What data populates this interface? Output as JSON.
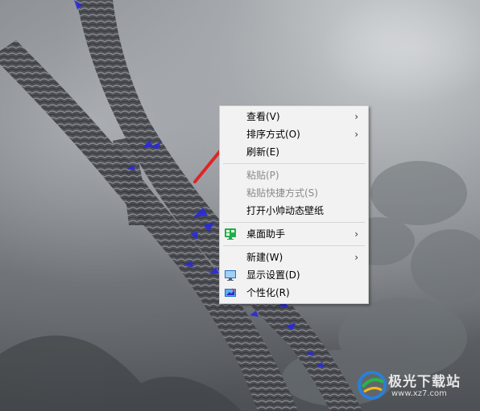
{
  "context_menu": {
    "items": [
      {
        "label": "查看(V)",
        "submenu": true,
        "enabled": true
      },
      {
        "label": "排序方式(O)",
        "submenu": true,
        "enabled": true
      },
      {
        "label": "刷新(E)",
        "submenu": false,
        "enabled": true
      },
      {
        "label": "粘贴(P)",
        "submenu": false,
        "enabled": false
      },
      {
        "label": "粘贴快捷方式(S)",
        "submenu": false,
        "enabled": false
      },
      {
        "label": "打开小帅动态壁纸",
        "submenu": false,
        "enabled": true
      },
      {
        "label": "桌面助手",
        "submenu": true,
        "enabled": true,
        "icon": "desktop-assistant-icon"
      },
      {
        "label": "新建(W)",
        "submenu": true,
        "enabled": true
      },
      {
        "label": "显示设置(D)",
        "submenu": false,
        "enabled": true,
        "icon": "display-settings-icon"
      },
      {
        "label": "个性化(R)",
        "submenu": false,
        "enabled": true,
        "icon": "personalize-icon"
      }
    ],
    "arrow_glyph": "›"
  },
  "watermark": {
    "brand": "极光下载站",
    "url": "www.xz7.com"
  },
  "colors": {
    "accent_red": "#e02424",
    "butterfly_blue": "#2a2ad8"
  }
}
